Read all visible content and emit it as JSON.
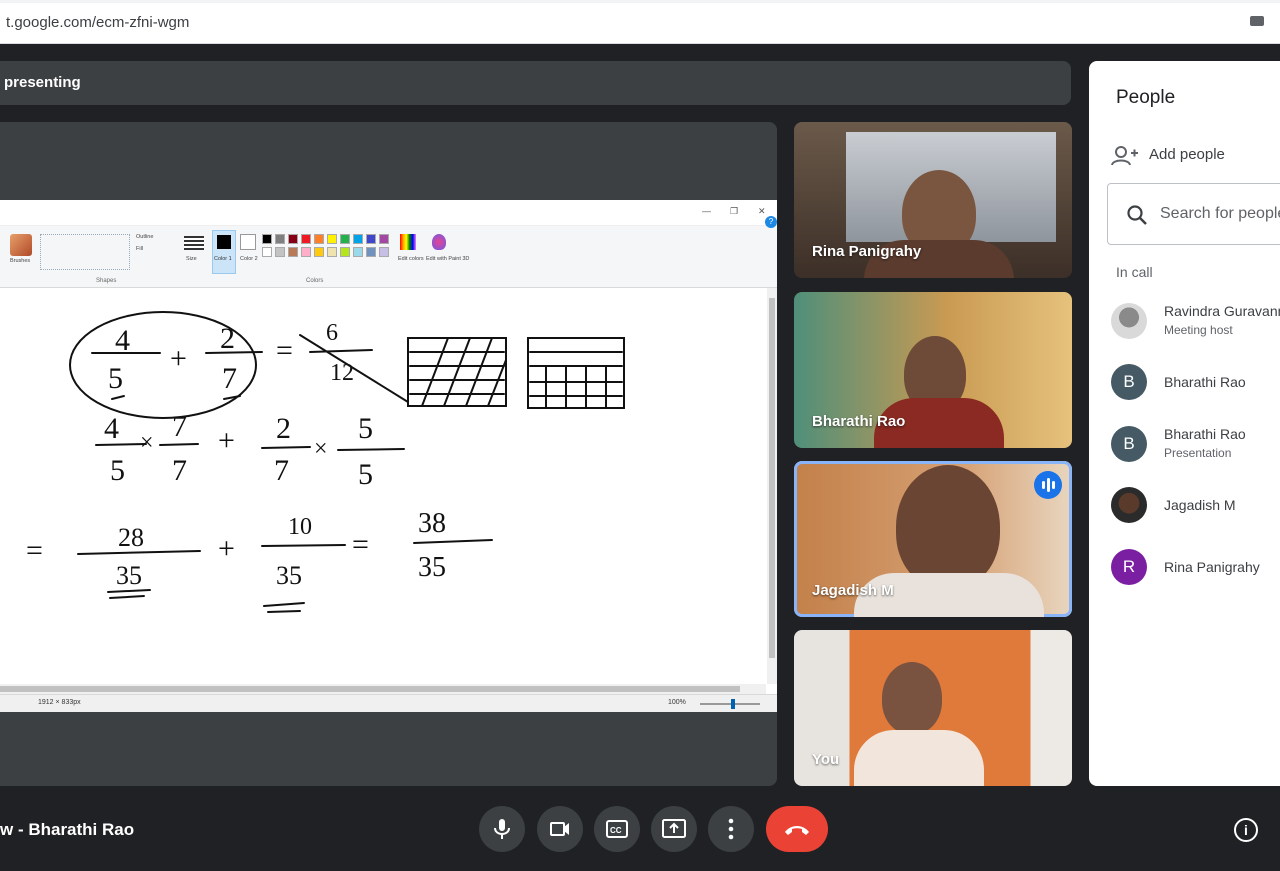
{
  "browser": {
    "url": "t.google.com/ecm-zfni-wgm"
  },
  "presentation": {
    "banner": "presenting"
  },
  "paint": {
    "groups": {
      "brushes": "Brushes",
      "shapes": "Shapes",
      "colors": "Colors",
      "size": "Size",
      "color1": "Color 1",
      "color2": "Color 2",
      "edit_colors": "Edit colors",
      "edit_3d": "Edit with Paint 3D",
      "outline": "Outline",
      "fill": "Fill"
    },
    "status": {
      "dimensions": "1912 × 833px",
      "zoom": "100%"
    },
    "palette": [
      "#000000",
      "#7f7f7f",
      "#880015",
      "#ed1c24",
      "#ff7f27",
      "#fff200",
      "#22b14c",
      "#00a2e8",
      "#3f48cc",
      "#a349a4",
      "#ffffff",
      "#c3c3c3",
      "#b97a57",
      "#ffaec9",
      "#ffc90e",
      "#efe4b0",
      "#b5e61d",
      "#99d9ea",
      "#7092be",
      "#c8bfe7"
    ],
    "whiteboard": {
      "eq1": {
        "n1": "4",
        "d1": "5",
        "op": "+",
        "n2": "2",
        "d2": "7",
        "eq": "=",
        "rn": "6",
        "rd": "12"
      },
      "eq2": {
        "a": "4",
        "b": "5",
        "c": "7",
        "d": "7",
        "e": "2",
        "f": "7",
        "g": "5",
        "h": "5",
        "times": "×",
        "plus": "+"
      },
      "eq3": {
        "eq": "=",
        "n1": "28",
        "d1": "35",
        "plus": "+",
        "n2": "10",
        "d2": "35",
        "eq2": "=",
        "rn": "38",
        "rd": "35"
      }
    }
  },
  "tiles": [
    {
      "name": "Rina Panigrahy"
    },
    {
      "name": "Bharathi Rao"
    },
    {
      "name": "Jagadish M"
    },
    {
      "name": "You"
    }
  ],
  "people_panel": {
    "title": "People",
    "add_people": "Add people",
    "search_placeholder": "Search for people",
    "in_call_label": "In call",
    "participants": [
      {
        "name": "Ravindra Guravannavar",
        "role": "Meeting host",
        "initial": ""
      },
      {
        "name": "Bharathi Rao",
        "role": "",
        "initial": "B"
      },
      {
        "name": "Bharathi Rao",
        "role": "Presentation",
        "initial": "B"
      },
      {
        "name": "Jagadish M",
        "role": "",
        "initial": ""
      },
      {
        "name": "Rina Panigrahy",
        "role": "",
        "initial": "R"
      }
    ]
  },
  "bottom_bar": {
    "meeting_label": "w - Bharathi Rao",
    "info_glyph": "i"
  },
  "colors": {
    "end_call": "#ea4335",
    "active_speaker": "#8ab4f8",
    "avatar_b": "#455a64",
    "avatar_r": "#7b1fa2"
  }
}
